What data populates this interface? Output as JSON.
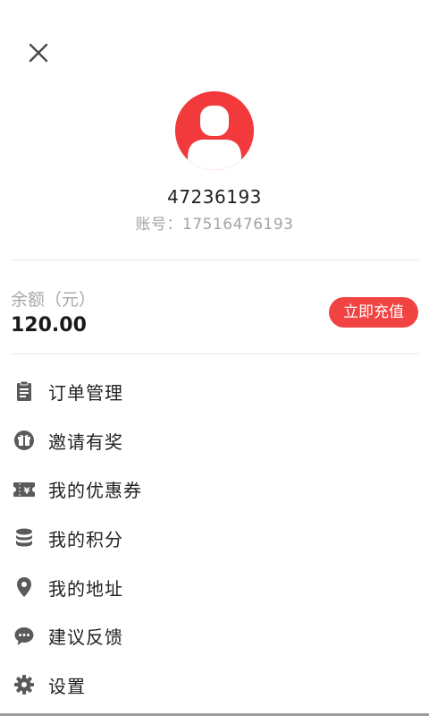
{
  "profile": {
    "username": "47236193",
    "account_line": "账号：17516476193"
  },
  "balance": {
    "label": "余额（元）",
    "value": "120.00",
    "recharge_label": "立即充值"
  },
  "menu": {
    "items": [
      {
        "label": "订单管理",
        "icon": "clipboard-icon"
      },
      {
        "label": "邀请有奖",
        "icon": "gift-icon"
      },
      {
        "label": "我的优惠券",
        "icon": "coupon-icon"
      },
      {
        "label": "我的积分",
        "icon": "database-icon"
      },
      {
        "label": "我的地址",
        "icon": "location-pin-icon"
      },
      {
        "label": "建议反馈",
        "icon": "chat-bubble-icon"
      },
      {
        "label": "设置",
        "icon": "gear-icon"
      }
    ]
  },
  "colors": {
    "accent": "#f2393b",
    "icon_gray": "#5a5a5a",
    "muted_text": "#a3a3a3"
  }
}
